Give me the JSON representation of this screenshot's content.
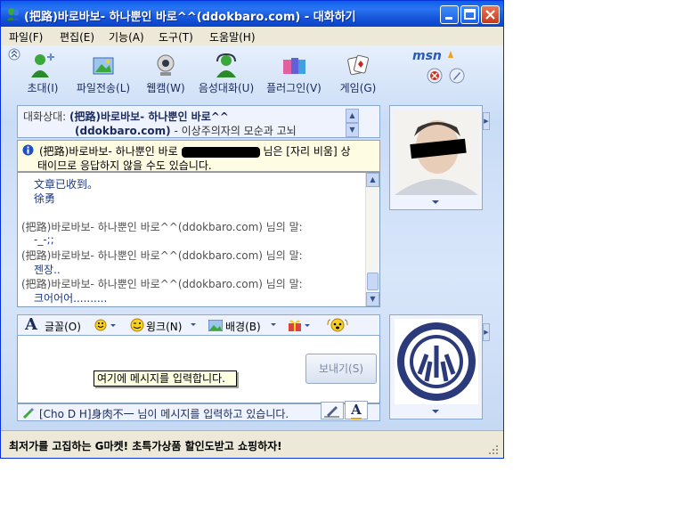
{
  "window": {
    "title": "(把路)바로바보- 하나뿐인 바로^^(ddokbaro.com) - 대화하기",
    "minimize_label": "minimize",
    "maximize_label": "maximize",
    "close_label": "close"
  },
  "menu": {
    "items": [
      "파일(F)",
      "편집(E)",
      "기능(A)",
      "도구(T)",
      "도움말(H)"
    ]
  },
  "toolbar": {
    "items": [
      {
        "label": "초대(I)",
        "icon": "invite-icon"
      },
      {
        "label": "파일전송(L)",
        "icon": "file-transfer-icon"
      },
      {
        "label": "웹캠(W)",
        "icon": "webcam-icon"
      },
      {
        "label": "음성대화(U)",
        "icon": "voice-chat-icon"
      },
      {
        "label": "플러그인(V)",
        "icon": "plugin-icon"
      },
      {
        "label": "게임(G)",
        "icon": "game-icon"
      }
    ],
    "brand": "msn"
  },
  "header": {
    "label": "대화상대:",
    "contact_name": "(把路)바로바보- 하나뿐인 바로^^",
    "contact_email": "(ddokbaro.com)",
    "contact_status": "- 이상주의자의 모순과 고뇌"
  },
  "notice": {
    "line1_prefix": "(把路)바로바보- 하나뿐인 바로",
    "line1_suffix": "님은 [자리 비움] 상",
    "line2": "태이므로 응답하지 않을 수도 있습니다."
  },
  "messages": [
    {
      "text": "文章已收到。",
      "type": "body"
    },
    {
      "text": "徐勇",
      "type": "body"
    },
    {
      "text": "(把路)바로바보- 하나뿐인 바로^^(ddokbaro.com) 님의 말:",
      "type": "sender"
    },
    {
      "text": "-_-;;",
      "type": "body"
    },
    {
      "text": "(把路)바로바보- 하나뿐인 바로^^(ddokbaro.com) 님의 말:",
      "type": "sender"
    },
    {
      "text": "젠장..",
      "type": "body"
    },
    {
      "text": "(把路)바로바보- 하나뿐인 바로^^(ddokbaro.com) 님의 말:",
      "type": "sender"
    },
    {
      "text": "크어어어..........",
      "type": "body"
    }
  ],
  "format_bar": {
    "font": "글꼴(O)",
    "wink": "윙크(N)",
    "background": "배경(B)"
  },
  "input": {
    "value": "",
    "send_label": "보내기(S)",
    "tooltip": "여기에 메시지를 입력합니다."
  },
  "typing_status": "[Cho D H]身肉不一 님이 메시지를 입력하고 있습니다.",
  "status_ad": "최저가를 고집하는 G마켓! 초특가상품 할인도받고 쇼핑하자!",
  "colors": {
    "title_blue": "#1353d8",
    "body_blue": "#d8e6fa",
    "msn_orange": "#f0a020",
    "message_blue": "#1a3a8a"
  }
}
